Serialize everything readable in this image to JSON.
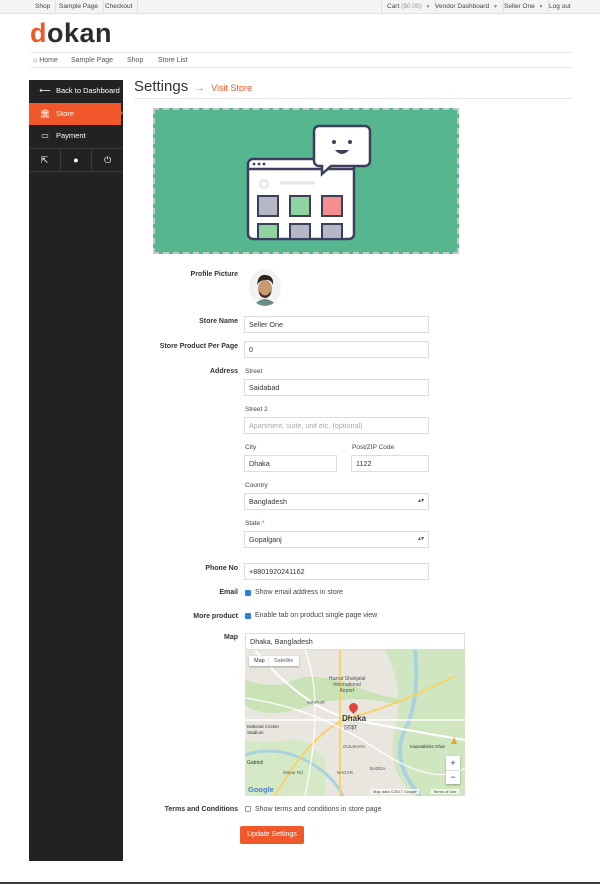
{
  "topbar": {
    "left_links": [
      "Shop",
      "Sample Page",
      "Checkout"
    ],
    "cart_label": "Cart",
    "cart_amount": "($0.00)",
    "vendor_dashboard": "Vendor Dashboard",
    "user": "Seller One",
    "logout": "Log out"
  },
  "logo": {
    "first_letter": "d",
    "rest": "okan"
  },
  "nav": {
    "home": "Home",
    "items": [
      "Sample Page",
      "Shop",
      "Store List"
    ]
  },
  "sidebar": {
    "back": "Back to Dashboard",
    "store": "Store",
    "payment": "Payment"
  },
  "page": {
    "title": "Settings",
    "arrow": "→",
    "visit_store": "Visit Store"
  },
  "form": {
    "profile_picture_label": "Profile Picture",
    "store_name_label": "Store Name",
    "store_name_value": "Seller One",
    "ppp_label": "Store Product Per Page",
    "ppp_value": "0",
    "address_label": "Address",
    "street_label": "Street",
    "street_value": "Saidabad",
    "street2_label": "Street 2",
    "street2_placeholder": "Apartment, suite, unit etc. (optional)",
    "city_label": "City",
    "city_value": "Dhaka",
    "zip_label": "Post/ZIP Code",
    "zip_value": "1122",
    "country_label": "Country",
    "country_value": "Bangladesh",
    "state_label": "State",
    "state_required": "*",
    "state_value": "Gopalganj",
    "phone_label": "Phone No",
    "phone_value": "+8801920241162",
    "email_label": "Email",
    "email_check_text": "Show email address in store",
    "more_label": "More product",
    "more_check_text": "Enable tab on product single page view",
    "map_label": "Map",
    "map_search_value": "Dhaka, Bangladesh",
    "terms_label": "Terms and Conditions",
    "terms_check_text": "Show terms and conditions in store page",
    "update_button": "Update Settings"
  },
  "map": {
    "tab_map": "Map",
    "tab_satellite": "Satellite",
    "labels": [
      "Hazrat Shahjalal International Airport",
      "MIRPUR",
      "Dhaka",
      "ঢাকা",
      "Kapotakkha Ghat",
      "National Cricket Stadium",
      "GULSHAN",
      "Gabtoli",
      "Mirpur Rd",
      "BADDA",
      "NAGAR"
    ],
    "attribution": "Map data ©2017 Google",
    "terms": "Terms of Use",
    "google": "Google",
    "zoom_in": "+",
    "zoom_out": "−"
  },
  "colors": {
    "accent": "#f0582c",
    "sidebar": "#222222",
    "banner": "#56b690",
    "checkbox": "#2f7fe0"
  }
}
